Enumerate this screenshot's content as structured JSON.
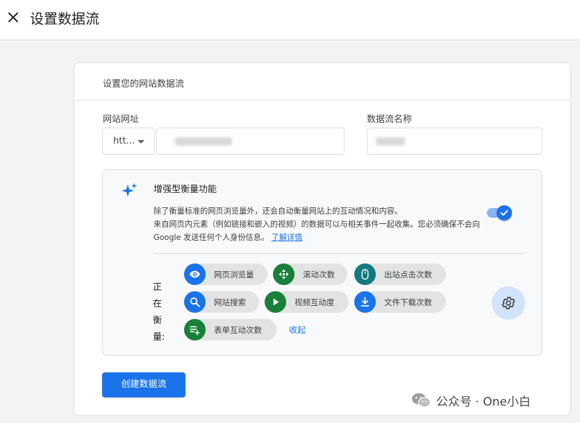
{
  "header": {
    "title": "设置数据流",
    "close_icon": "close-icon"
  },
  "card": {
    "title": "设置您的网站数据流"
  },
  "form": {
    "website_url": {
      "label": "网站网址",
      "protocol": "htt...",
      "value": ""
    },
    "stream_name": {
      "label": "数据流名称",
      "value": ""
    }
  },
  "enhanced": {
    "title": "增强型衡量功能",
    "desc_line1": "除了衡量标准的网页浏览量外，还会自动衡量网站上的互动情况和内容。",
    "desc_line2": "来自网页内元素（例如链接和嵌入的视频）的数据可以与相关事件一起收集。您必须确保不会向 Google 发送任何个人身份信息。",
    "learn_more": "了解详情",
    "enabled": true,
    "measuring_label": "正在衡量:",
    "chips": [
      {
        "label": "网页浏览量",
        "icon": "eye-icon",
        "color": "#1a73e8"
      },
      {
        "label": "滚动次数",
        "icon": "scroll-arrows-icon",
        "color": "#188038"
      },
      {
        "label": "出站点击次数",
        "icon": "mouse-icon",
        "color": "#137a7f"
      },
      {
        "label": "网站搜索",
        "icon": "search-icon",
        "color": "#1a73e8"
      },
      {
        "label": "视频互动度",
        "icon": "play-icon",
        "color": "#188038"
      },
      {
        "label": "文件下载次数",
        "icon": "download-icon",
        "color": "#1a73e8"
      },
      {
        "label": "表单互动次数",
        "icon": "form-add-icon",
        "color": "#188038"
      }
    ],
    "collapse": "收起",
    "settings_icon": "gear-icon"
  },
  "actions": {
    "create": "创建数据流"
  },
  "watermark": {
    "text": "公众号 · One小白"
  }
}
